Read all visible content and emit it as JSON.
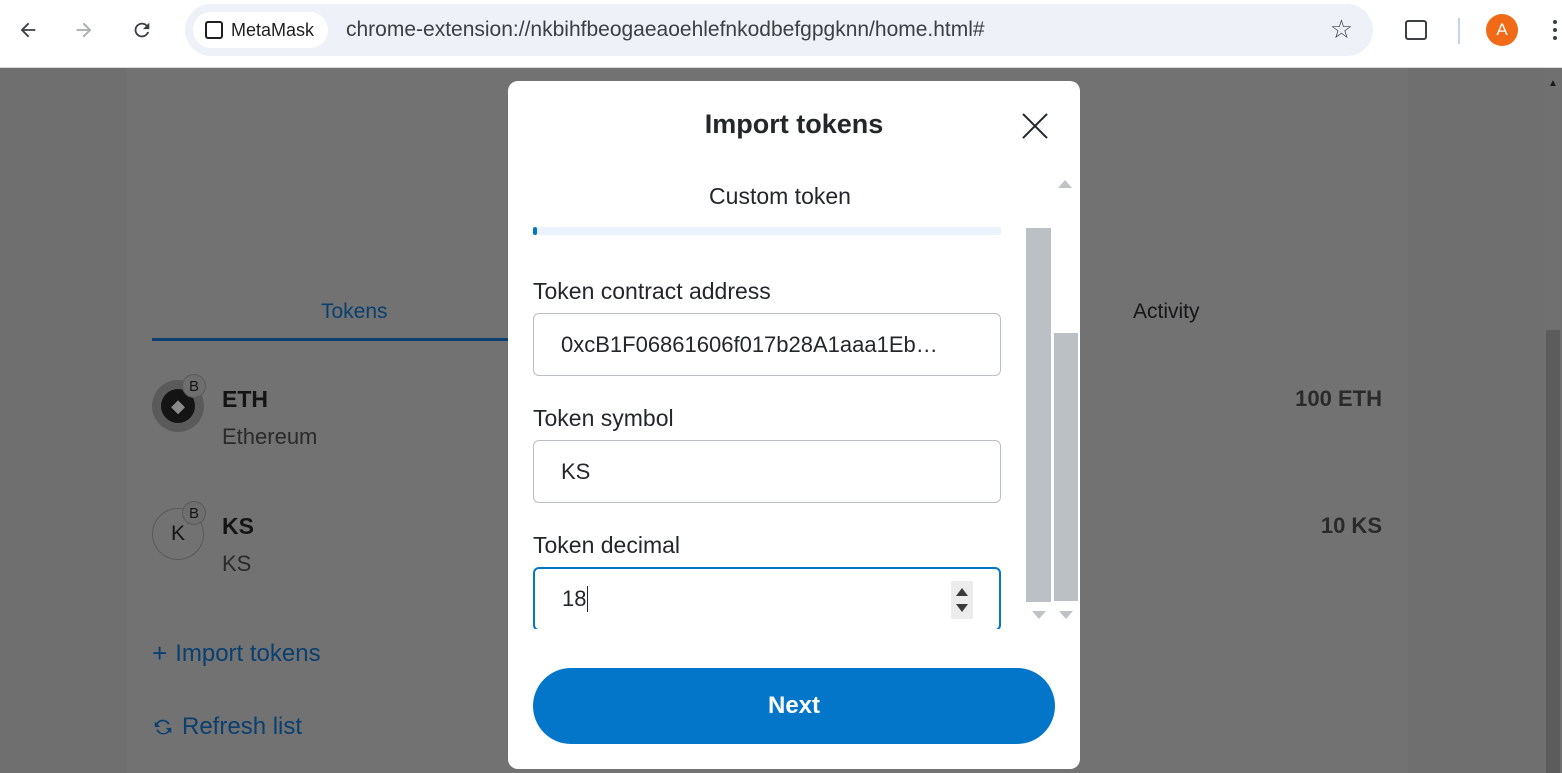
{
  "browser": {
    "back_icon": "arrow-left-icon",
    "forward_icon": "arrow-right-icon",
    "reload_icon": "reload-icon",
    "extension_name": "MetaMask",
    "url": "chrome-extension://nkbihfbeogaeaoehlefnkodbefgpgknn/home.html#",
    "profile_initial": "A",
    "profile_color": "#f06a18"
  },
  "wallet": {
    "tabs": [
      {
        "label": "Tokens",
        "active": true
      },
      {
        "label": "Activity",
        "active": false
      }
    ],
    "tokens": [
      {
        "symbol": "ETH",
        "name": "Ethereum",
        "balance": "100 ETH",
        "icon_letter": "",
        "network_badge": "B"
      },
      {
        "symbol": "KS",
        "name": "KS",
        "balance": "10 KS",
        "icon_letter": "K",
        "network_badge": "B"
      }
    ],
    "import_tokens_label": "Import tokens",
    "refresh_list_label": "Refresh list",
    "accent": "#0a3f70"
  },
  "modal": {
    "title": "Import tokens",
    "section_title": "Custom token",
    "contract_address_label": "Token contract address",
    "contract_address_value": "0xcB1F06861606f017b28A1aaa1Eb…",
    "symbol_label": "Token symbol",
    "symbol_value": "KS",
    "decimal_label": "Token decimal",
    "decimal_value": "18",
    "next_label": "Next",
    "primary_color": "#0376c9"
  }
}
